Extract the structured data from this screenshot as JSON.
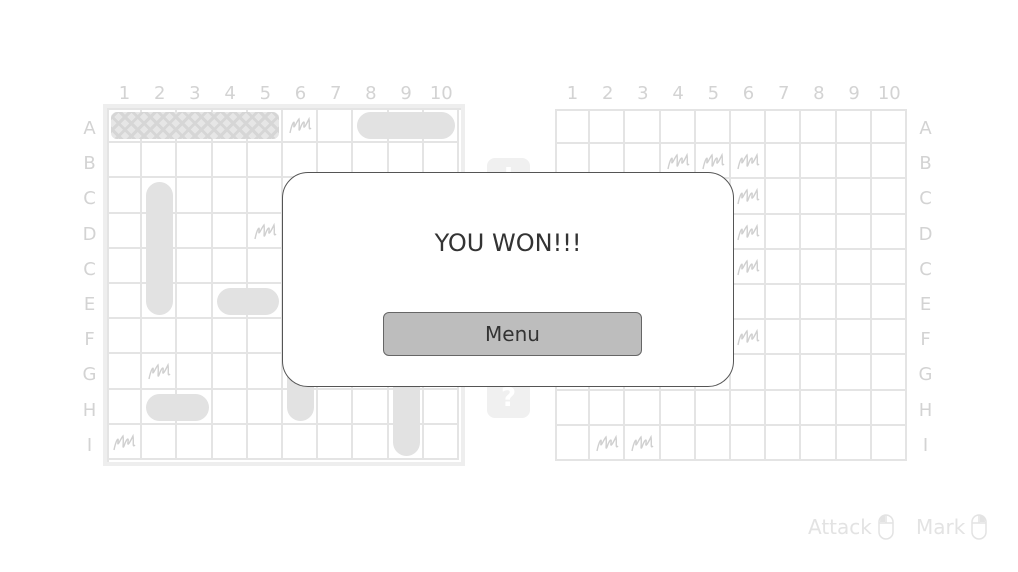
{
  "columns": [
    "1",
    "2",
    "3",
    "4",
    "5",
    "6",
    "7",
    "8",
    "9",
    "10"
  ],
  "rows": [
    "A",
    "B",
    "C",
    "D",
    "C",
    "E",
    "F",
    "G",
    "H",
    "I"
  ],
  "modal": {
    "title": "YOU WON!!!",
    "menu_label": "Menu"
  },
  "controls": {
    "attack_label": "Attack",
    "mark_label": "Mark"
  },
  "ghost_buttons": [
    "!",
    "?"
  ],
  "colors": {
    "grid_line": "#e4e4e4",
    "ship": "#e2e2e2",
    "label": "#d3d3d3",
    "modal_border": "#555555",
    "button": "#bdbdbd"
  },
  "player_board": {
    "ships": [
      {
        "row": 0,
        "col": 0,
        "len": 5,
        "dir": "h",
        "sunk": true
      },
      {
        "row": 0,
        "col": 7,
        "len": 3,
        "dir": "h",
        "sunk": false
      },
      {
        "row": 2,
        "col": 1,
        "len": 4,
        "dir": "v",
        "sunk": false
      },
      {
        "row": 5,
        "col": 3,
        "len": 2,
        "dir": "h",
        "sunk": false
      },
      {
        "row": 8,
        "col": 1,
        "len": 2,
        "dir": "h",
        "sunk": false
      },
      {
        "row": 7,
        "col": 5,
        "len": 2,
        "dir": "v",
        "sunk": false
      },
      {
        "row": 7,
        "col": 8,
        "len": 3,
        "dir": "v",
        "sunk": false
      }
    ],
    "misses": [
      [
        0,
        5
      ],
      [
        3,
        4
      ],
      [
        7,
        1
      ],
      [
        9,
        0
      ]
    ]
  },
  "enemy_board": {
    "misses": [
      [
        1,
        3
      ],
      [
        1,
        4
      ],
      [
        1,
        5
      ],
      [
        2,
        5
      ],
      [
        3,
        5
      ],
      [
        4,
        5
      ],
      [
        6,
        5
      ],
      [
        9,
        1
      ],
      [
        9,
        2
      ]
    ]
  }
}
